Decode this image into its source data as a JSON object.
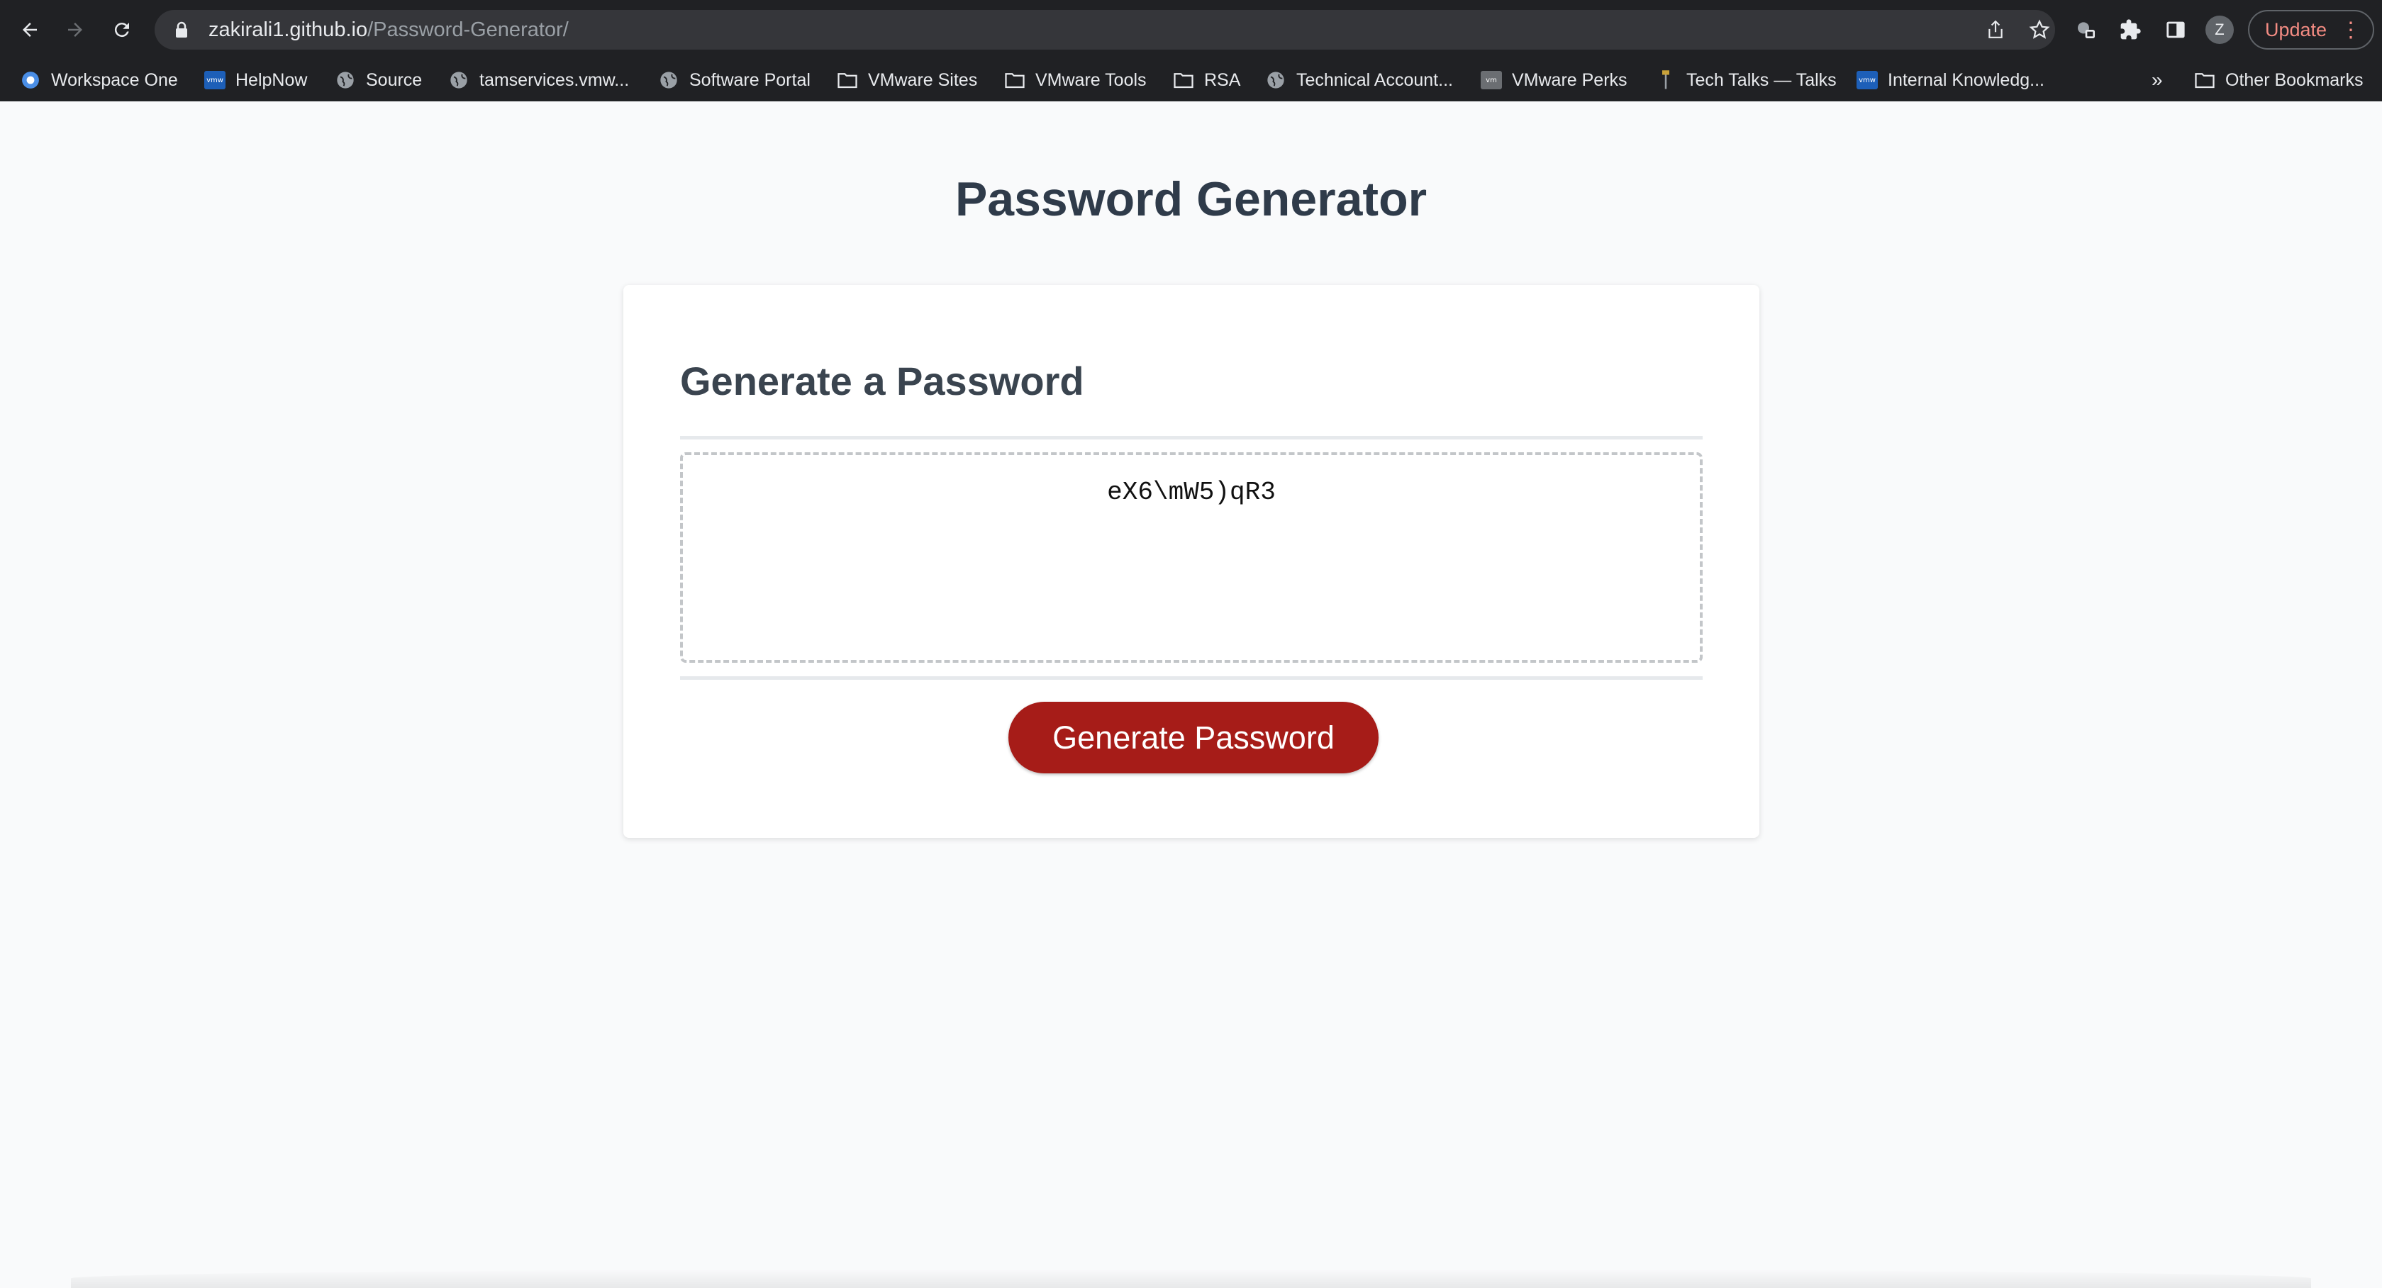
{
  "browser": {
    "url_host": "zakirali1.github.io",
    "url_path": "/Password-Generator/",
    "update_label": "Update",
    "avatar_letter": "Z",
    "overflow_label": "»",
    "bookmarks": [
      {
        "label": "Workspace One",
        "icon": "workspace-one-icon"
      },
      {
        "label": "HelpNow",
        "icon": "vmw-icon"
      },
      {
        "label": "Source",
        "icon": "globe-icon"
      },
      {
        "label": "tamservices.vmw...",
        "icon": "globe-icon"
      },
      {
        "label": "Software Portal",
        "icon": "globe-icon"
      },
      {
        "label": "VMware Sites",
        "icon": "folder-icon"
      },
      {
        "label": "VMware Tools",
        "icon": "folder-icon"
      },
      {
        "label": "RSA",
        "icon": "folder-icon"
      },
      {
        "label": "Technical Account...",
        "icon": "globe-icon"
      },
      {
        "label": "VMware Perks",
        "icon": "vm-icon"
      },
      {
        "label": "Tech Talks — Talks",
        "icon": "tech-talks-icon"
      },
      {
        "label": "Internal Knowledg...",
        "icon": "vmw-icon"
      }
    ],
    "other_bookmarks": "Other Bookmarks"
  },
  "page": {
    "title": "Password Generator",
    "card_title": "Generate a Password",
    "password_value": "eX6\\mW5)qR3",
    "generate_button": "Generate Password"
  },
  "colors": {
    "button": "#a61c18",
    "page_background": "#f9fafb",
    "chrome_background": "#202124"
  }
}
